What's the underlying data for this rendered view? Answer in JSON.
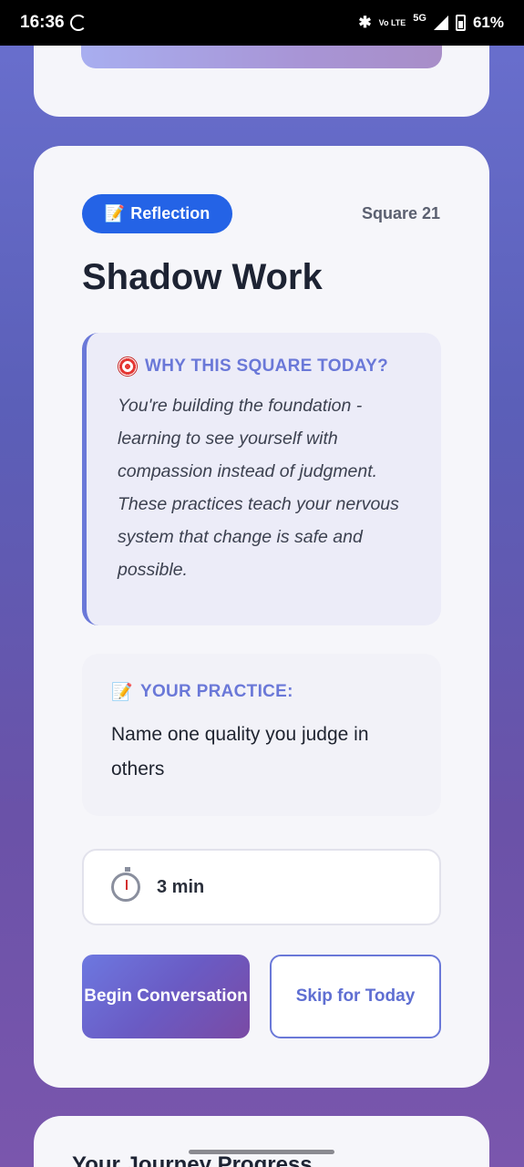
{
  "status_bar": {
    "time": "16:36",
    "network_small": "Vo LTE",
    "network_5g": "5G",
    "battery": "61%"
  },
  "card": {
    "badge_icon": "📝",
    "badge_label": "Reflection",
    "square_label": "Square 21",
    "title": "Shadow Work",
    "why": {
      "heading": "WHY THIS SQUARE TODAY?",
      "text": "You're building the foundation - learning to see yourself with compassion instead of judgment. These practices teach your nervous system that change is safe and possible."
    },
    "practice": {
      "heading": "YOUR PRACTICE:",
      "text": "Name one quality you judge in others"
    },
    "time": "3 min",
    "begin_label": "Begin Conversation",
    "skip_label": "Skip for Today"
  },
  "next_card": {
    "title": "Your Journey Progress"
  }
}
